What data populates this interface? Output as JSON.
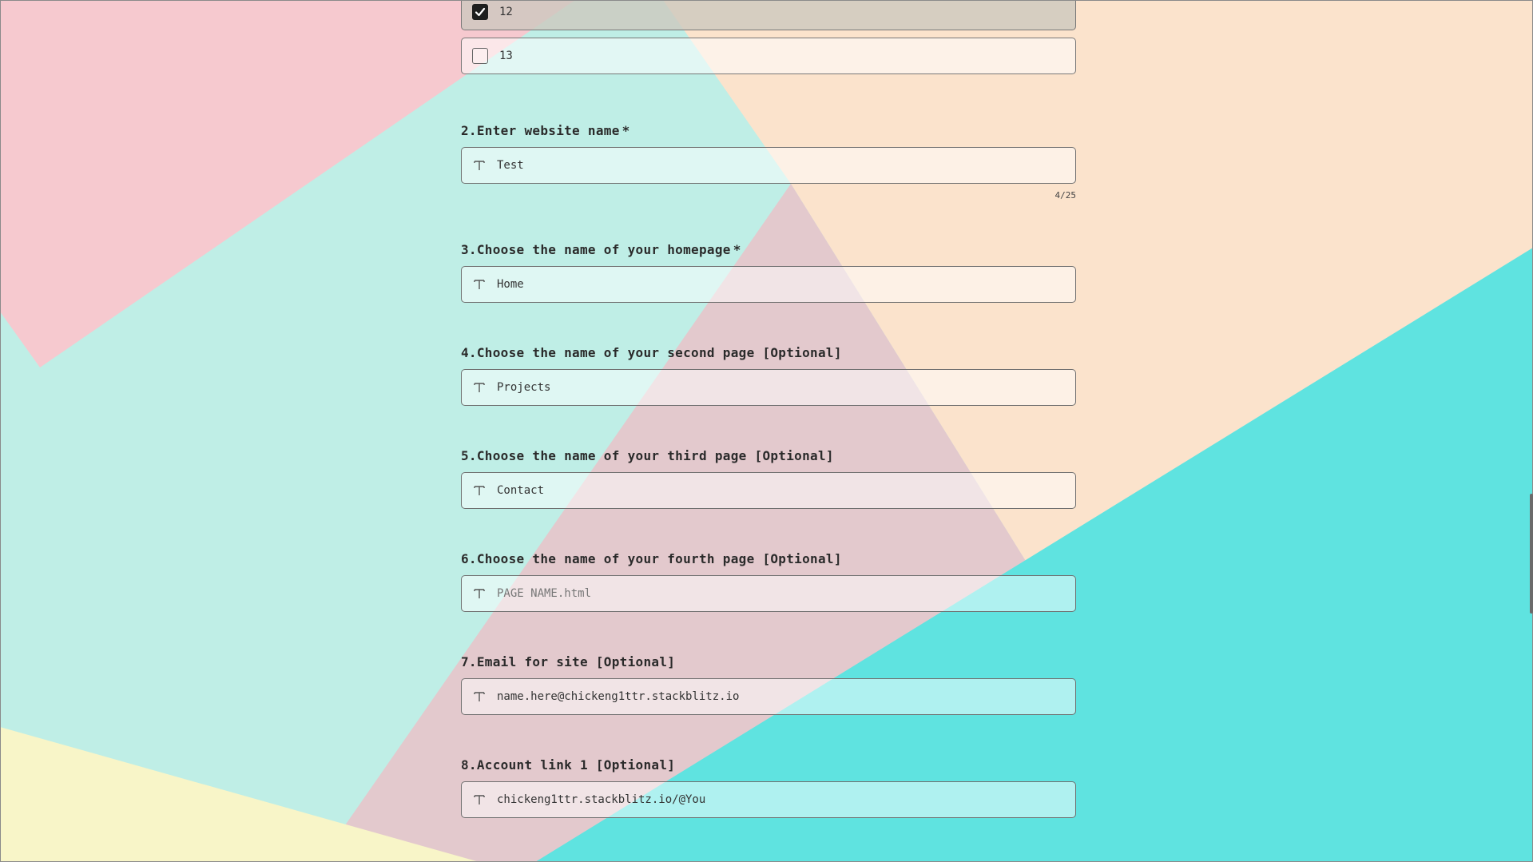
{
  "choices": [
    {
      "label": "12",
      "checked": true
    },
    {
      "label": "13",
      "checked": false
    }
  ],
  "questions": [
    {
      "label": "2.Enter website name",
      "required": "*",
      "value": "Test",
      "placeholder": "",
      "counter": "4/25"
    },
    {
      "label": "3.Choose the name of your homepage",
      "required": "*",
      "value": "Home",
      "placeholder": ""
    },
    {
      "label": "4.Choose the name of your second page [Optional]",
      "value": "Projects",
      "placeholder": ""
    },
    {
      "label": "5.Choose the name of your third page [Optional]",
      "value": "Contact",
      "placeholder": ""
    },
    {
      "label": "6.Choose the name of your fourth page [Optional]",
      "value": "",
      "placeholder": "PAGE NAME.html"
    },
    {
      "label": "7.Email for site [Optional]",
      "value": "name.here@chickeng1ttr.stackblitz.io",
      "placeholder": ""
    },
    {
      "label": "8.Account link 1 [Optional]",
      "value": "chickeng1ttr.stackblitz.io/@You",
      "placeholder": ""
    }
  ],
  "colors": {
    "pink": "#f6c9cf",
    "mint": "#bfeee6",
    "peach": "#fbe3cc",
    "mauve": "#e3c9cd",
    "turquoise": "#5fe3e0",
    "lemon": "#f8f5c8",
    "checkbox_fill": "#1e1e1e"
  },
  "icons": {
    "field_type": "text-type-icon",
    "check": "checkmark-icon"
  }
}
